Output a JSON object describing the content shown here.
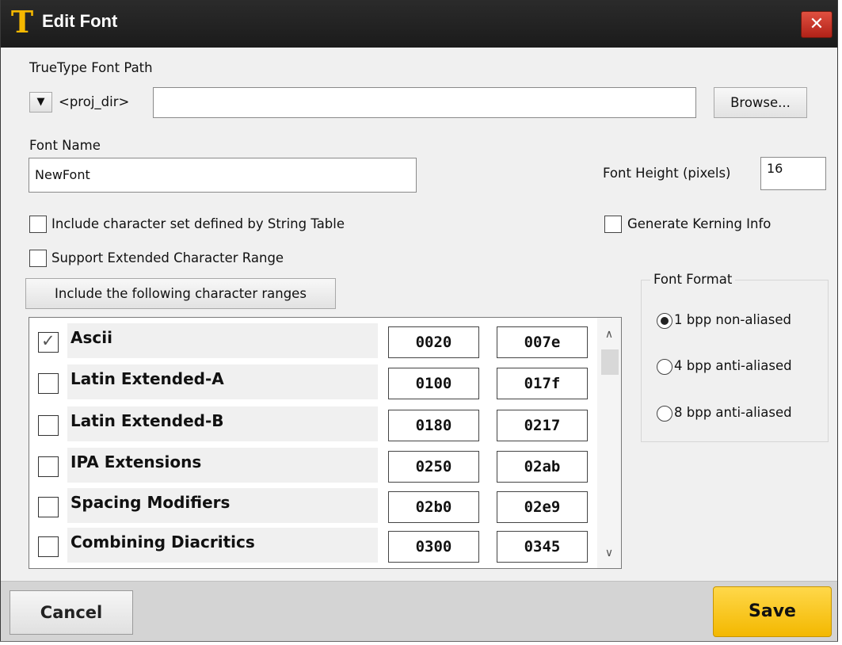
{
  "window": {
    "title": "Edit Font",
    "icon": "T",
    "close_label": "✕"
  },
  "font_path": {
    "label": "TrueType Font Path",
    "dropdown_arrow": "▼",
    "prefix": "<proj_dir>",
    "value": "",
    "browse_label": "Browse..."
  },
  "font_name": {
    "label": "Font Name",
    "value": "NewFont"
  },
  "font_height": {
    "label": "Font Height (pixels)",
    "value": "16"
  },
  "options": {
    "include_string_table": {
      "label": "Include character set defined by String Table",
      "checked": false
    },
    "support_extended": {
      "label": "Support Extended Character Range",
      "checked": false
    },
    "generate_kerning": {
      "label": "Generate Kerning Info",
      "checked": false
    }
  },
  "ranges_button_label": "Include the following character ranges",
  "ranges": [
    {
      "name": "Ascii",
      "start": "0020",
      "end": "007e",
      "checked": true
    },
    {
      "name": "Latin Extended-A",
      "start": "0100",
      "end": "017f",
      "checked": false
    },
    {
      "name": "Latin Extended-B",
      "start": "0180",
      "end": "0217",
      "checked": false
    },
    {
      "name": "IPA Extensions",
      "start": "0250",
      "end": "02ab",
      "checked": false
    },
    {
      "name": "Spacing Modifiers",
      "start": "02b0",
      "end": "02e9",
      "checked": false
    },
    {
      "name": "Combining Diacritics",
      "start": "0300",
      "end": "0345",
      "checked": false
    }
  ],
  "font_format": {
    "title": "Font Format",
    "options": [
      {
        "label": "1 bpp non-aliased",
        "selected": true
      },
      {
        "label": "4 bpp anti-aliased",
        "selected": false
      },
      {
        "label": "8 bpp anti-aliased",
        "selected": false
      }
    ]
  },
  "footer": {
    "cancel_label": "Cancel",
    "save_label": "Save"
  },
  "colors": {
    "title_bar": "#1e1e1e",
    "icon_accent": "#f5b800",
    "close_button": "#c8291b",
    "save_button": "#f5c000"
  },
  "scroll_icons": {
    "up": "∧",
    "down": "∨"
  }
}
